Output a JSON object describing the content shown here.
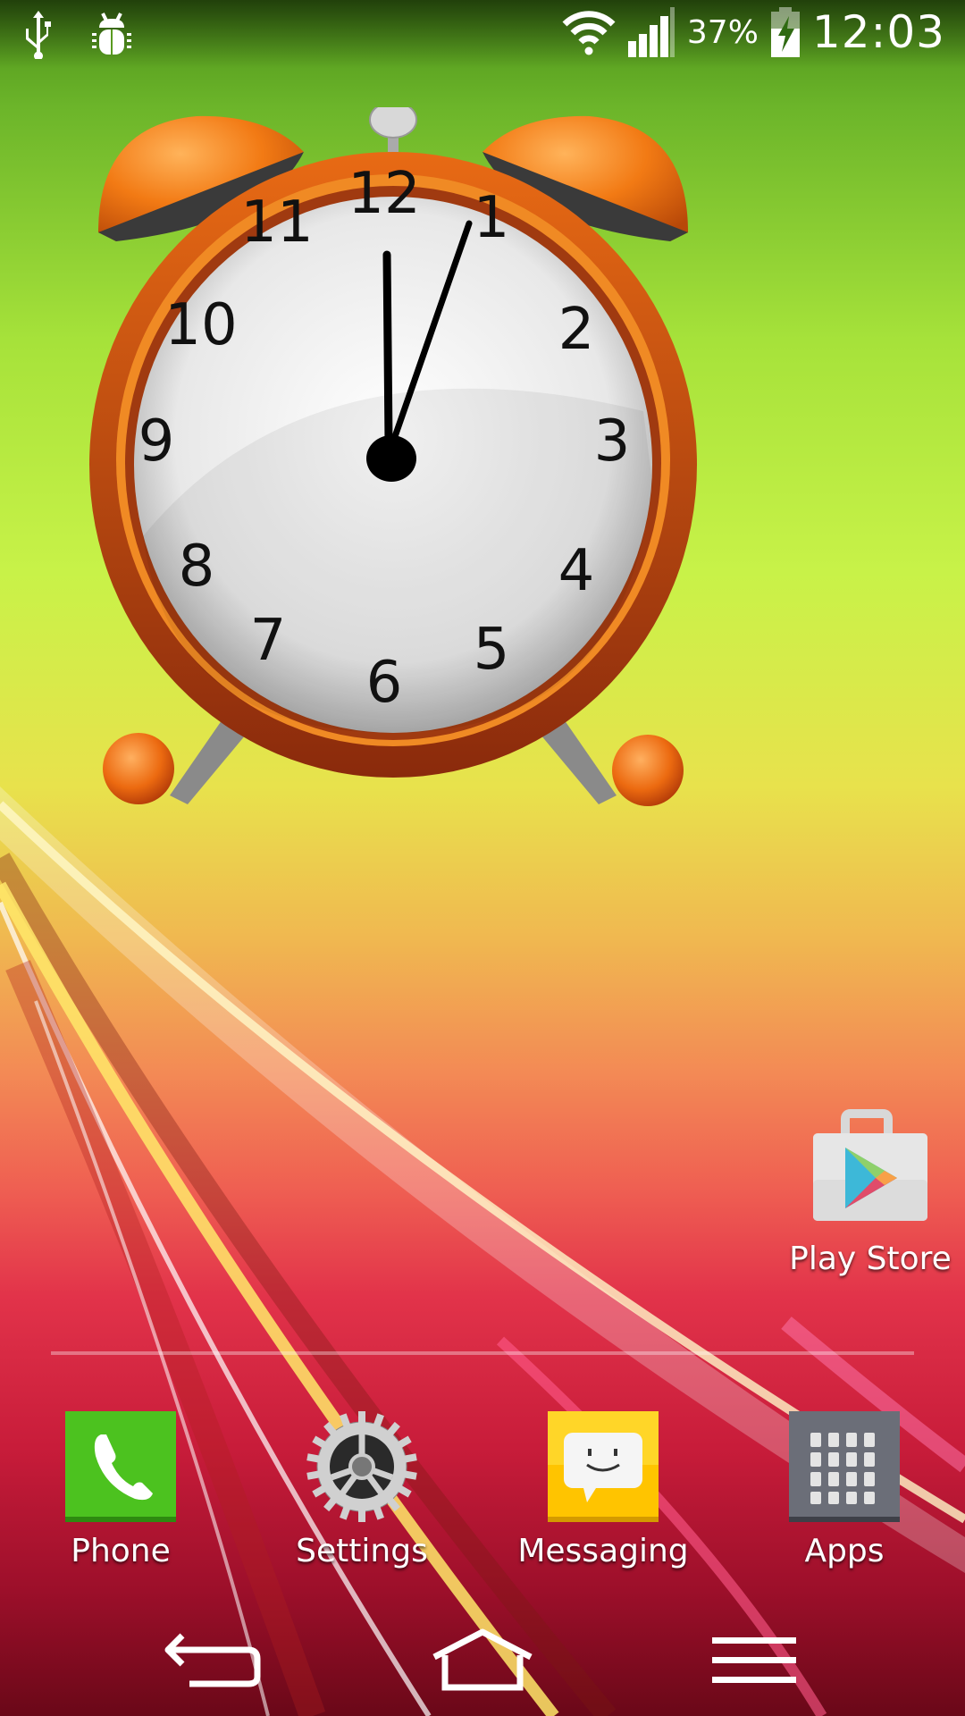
{
  "status_bar": {
    "left_icons": [
      "usb-icon",
      "debug-bug-icon"
    ],
    "wifi": "wifi-icon",
    "signal": "signal-bars-icon",
    "battery_percent": "37%",
    "battery_state": "charging",
    "time": "12:03"
  },
  "clock_widget": {
    "type": "analog-alarm-clock",
    "time_shown": "12:05",
    "numerals": [
      "12",
      "1",
      "2",
      "3",
      "4",
      "5",
      "6",
      "7",
      "8",
      "9",
      "10",
      "11"
    ]
  },
  "home_shortcuts": [
    {
      "label": "Play Store",
      "icon": "play-store-icon"
    }
  ],
  "dock": [
    {
      "label": "Phone",
      "icon": "phone-icon",
      "color": "#4cc21f"
    },
    {
      "label": "Settings",
      "icon": "gear-icon",
      "color": "#cfcfcf"
    },
    {
      "label": "Messaging",
      "icon": "message-bubble-icon",
      "color": "#ffc400"
    },
    {
      "label": "Apps",
      "icon": "app-grid-icon",
      "color": "#6b6e78"
    }
  ],
  "nav_bar": {
    "back": "back-arrow-icon",
    "home": "home-icon",
    "menu": "menu-icon"
  }
}
